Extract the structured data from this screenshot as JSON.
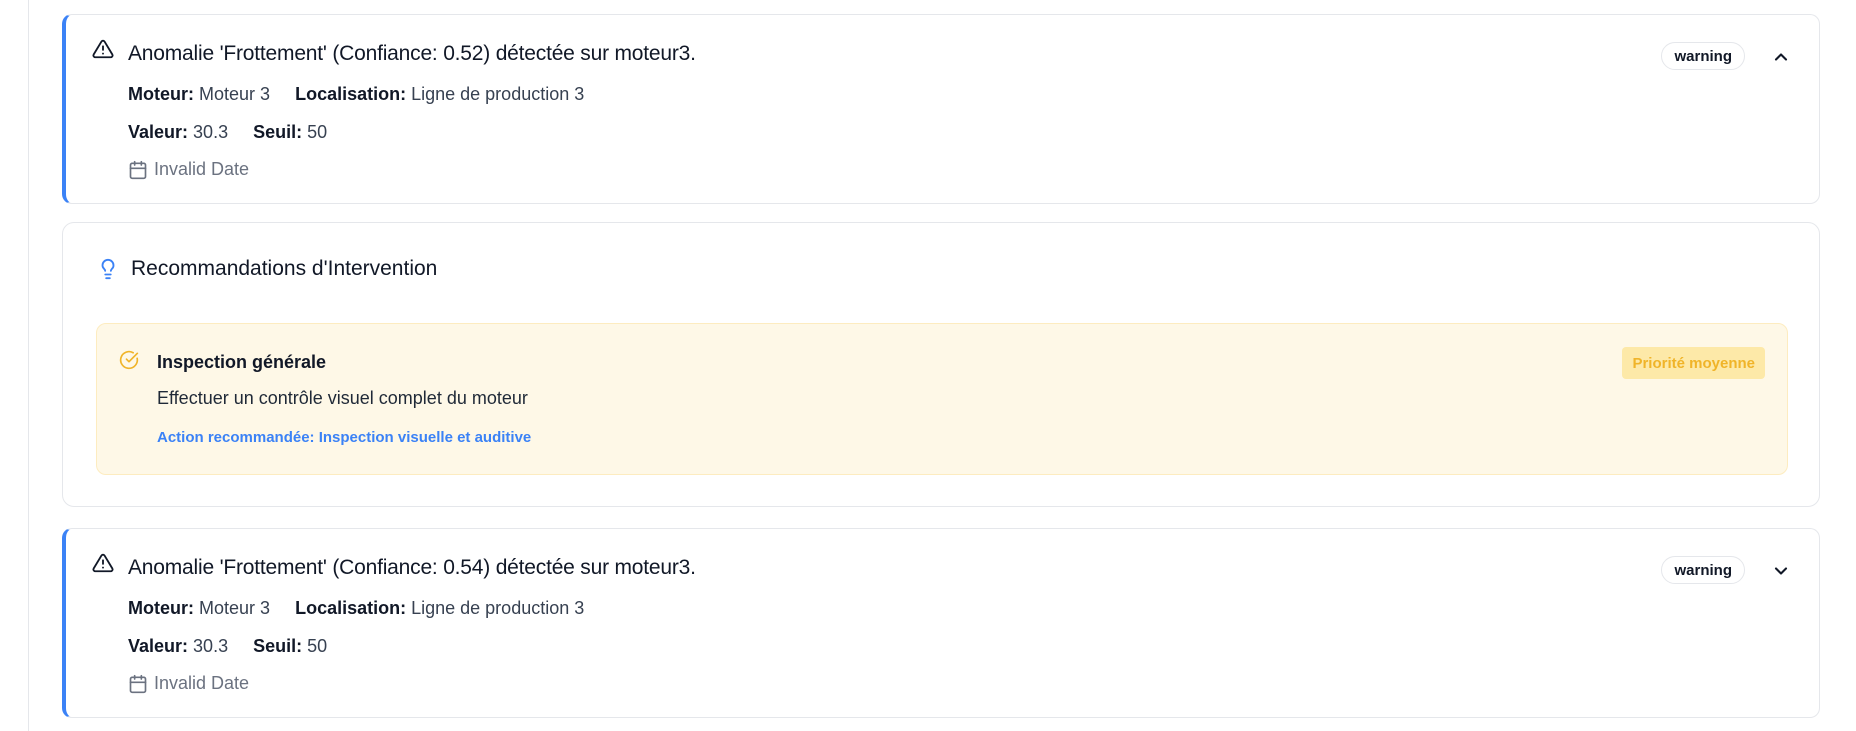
{
  "alerts": [
    {
      "title": "Anomalie 'Frottement' (Confiance: 0.52) détectée sur moteur3.",
      "motor_label": "Moteur:",
      "motor_value": "Moteur 3",
      "location_label": "Localisation:",
      "location_value": "Ligne de production 3",
      "value_label": "Valeur:",
      "value_value": "30.3",
      "threshold_label": "Seuil:",
      "threshold_value": "50",
      "date": "Invalid Date",
      "badge": "warning",
      "expanded": true,
      "chevron_icon": "chevron-up-icon"
    },
    {
      "title": "Anomalie 'Frottement' (Confiance: 0.54) détectée sur moteur3.",
      "motor_label": "Moteur:",
      "motor_value": "Moteur 3",
      "location_label": "Localisation:",
      "location_value": "Ligne de production 3",
      "value_label": "Valeur:",
      "value_value": "30.3",
      "threshold_label": "Seuil:",
      "threshold_value": "50",
      "date": "Invalid Date",
      "badge": "warning",
      "expanded": false,
      "chevron_icon": "chevron-down-icon"
    }
  ],
  "recommendations": {
    "title": "Recommandations d'Intervention",
    "icon": "lightbulb-icon",
    "items": [
      {
        "title": "Inspection générale",
        "description": "Effectuer un contrôle visuel complet du moteur",
        "action": "Action recommandée: Inspection visuelle et auditive",
        "priority": "Priorité moyenne",
        "icon": "check-circle-icon"
      }
    ]
  },
  "colors": {
    "accent_blue": "#3b82f6",
    "priority_bg": "#fde9a8",
    "priority_text": "#f0b429",
    "reco_bg": "#fef8e7"
  }
}
